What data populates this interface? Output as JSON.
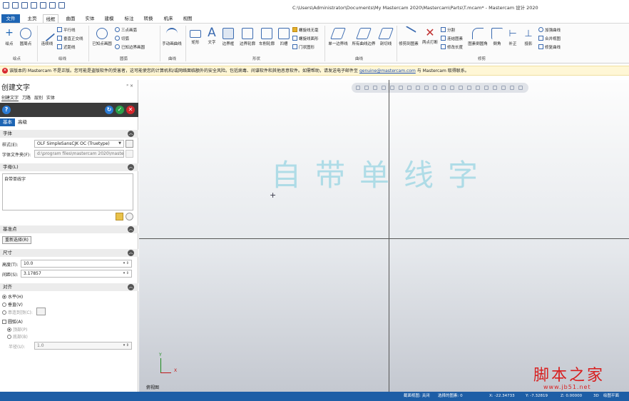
{
  "titlebar": {
    "title": "C:\\Users\\Administrator\\Documents\\My Mastercam 2020\\Mastercam\\Parts\\T.mcam* - Mastercam 设计 2020"
  },
  "menu": {
    "file": "文件",
    "tabs": [
      "主页",
      "线框",
      "曲面",
      "实体",
      "建模",
      "标注",
      "转换",
      "机床",
      "视图"
    ]
  },
  "ribbon": {
    "points": {
      "point": "绘点",
      "arc_center": "圆周点",
      "group": "绘点"
    },
    "wire": {
      "line": "连续线",
      "parallel": "平行线",
      "perpendicular": "垂直正交线",
      "nearest": "近距线",
      "circle": "已知点画圆",
      "three_point": "三点画弧",
      "tangent": "切弧",
      "edge_arc": "已知边界画圆",
      "group_lines": "绘线",
      "group_arcs": "圆弧"
    },
    "curves": {
      "manual": "手动画曲线",
      "group": "曲线"
    },
    "shapes": {
      "rect": "矩形",
      "text": "文字",
      "bbox": "边界框",
      "boundary": "边界轮廓",
      "lathe": "车削轮廓",
      "relief": "凹槽",
      "polygon": "螺旋线无毫",
      "spiral": "螺旋线面形",
      "door": "门状图形",
      "group": "形状"
    },
    "surf_curves": {
      "single": "单一边界线",
      "all": "所有曲线边界",
      "cut": "剖切线",
      "group": "曲线"
    },
    "modify": {
      "trim": "修剪到图素",
      "break": "两点打断",
      "split": "分割",
      "join": "连结图素",
      "modify_len": "修改长度",
      "fillet": "图素倒圆角",
      "chamfer": "倒角",
      "offset": "补正",
      "project": "投影",
      "add_to": "加强曲线",
      "merge": "合并视图",
      "fix": "修复曲线",
      "group": "修剪"
    }
  },
  "warning": {
    "text": "该版本的 Mastercam 不是正版。您可能是盗版软件的受害者，这可能使您的计算机和/或网络面临额外的安全风险。包括病毒、间谍软件和其他恶意软件。如需帮助，请发送电子邮件至",
    "email": "genuine@mastercam.com",
    "suffix": "与 Mastercam 取得联系。"
  },
  "panel": {
    "title": "创建文字",
    "ctrl": "ᵖ ×",
    "tabs": [
      "创建文字",
      "刀路",
      "层别",
      "实体"
    ],
    "subtabs": [
      "基本",
      "高级"
    ],
    "font_section": "字体",
    "style_label": "样式(E):",
    "style_value": "OLF SimpleSansCJK OC (Truetype)",
    "font_file_label": "字体文件夹(F):",
    "font_file_value": "d:\\program files\\mastercam 2020\\mastercam",
    "letters_section": "字母(L)",
    "letters_value": "自带单线字",
    "base_section": "基准点",
    "reselect": "重新选择(R)",
    "size_section": "尺寸",
    "height_label": "高度(T):",
    "height_value": "10.0",
    "spacing_label": "间距(S):",
    "spacing_value": "3.17857",
    "align_section": "对齐",
    "horizontal": "水平(H)",
    "vertical": "垂直(V)",
    "baseline": "串连到顶(C):",
    "arc": "圆弧(A)",
    "top": "顶部(P)",
    "bottom": "底部(B)",
    "radius_label": "半径(U):",
    "radius_value": "1.0"
  },
  "viewport": {
    "cad_text": "自带单线字",
    "view_label": "俯视图",
    "axis_y": "Y",
    "axis_x": "X",
    "watermark": "脚本之家",
    "watermark_url": "www.jb51.net"
  },
  "status": {
    "section": "截面视图: 关闭",
    "selected": "选择的图素: 0",
    "x": "X:  -22.34733",
    "y": "Y:  -7.32819",
    "z": "Z:  0.00000",
    "mode": "3D",
    "plane": "绘图平面"
  },
  "colors": {
    "accent": "#1e65b4",
    "status_bar": "#1e5ea6",
    "warning_bg": "#fff7d6",
    "cad_text": "#9fd7e4",
    "watermark": "#d81e1e"
  }
}
